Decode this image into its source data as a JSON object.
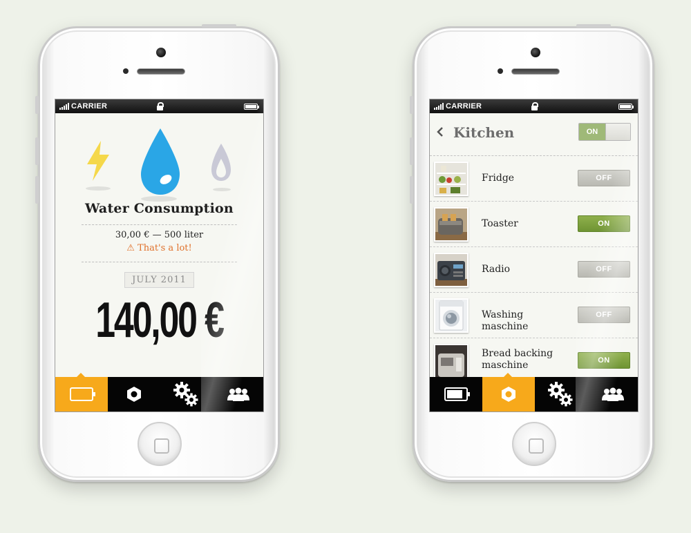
{
  "left_phone": {
    "status": {
      "carrier": "CARRIER"
    },
    "title": "Water Consumption",
    "consumption": {
      "cost": "30,00 €",
      "separator": "—",
      "volume": "500 liter"
    },
    "warning": "⚠ That's a lot!",
    "month": "JULY 2011",
    "amount": "140,00 €",
    "tabs": [
      {
        "icon": "battery-icon",
        "active": true
      },
      {
        "icon": "nut-icon",
        "active": false
      },
      {
        "icon": "gears-icon",
        "active": false
      },
      {
        "icon": "group-icon",
        "active": false
      }
    ]
  },
  "right_phone": {
    "status": {
      "carrier": "CARRIER"
    },
    "title": "Kitchen",
    "master_toggle": "ON",
    "devices": [
      {
        "name": "Fridge",
        "state": "OFF"
      },
      {
        "name": "Toaster",
        "state": "ON"
      },
      {
        "name": "Radio",
        "state": "OFF"
      },
      {
        "name": "Washing maschine",
        "state": "OFF"
      },
      {
        "name": "Bread backing maschine",
        "state": "ON"
      }
    ],
    "tabs": [
      {
        "icon": "battery-icon",
        "active": false
      },
      {
        "icon": "nut-icon",
        "active": true
      },
      {
        "icon": "gears-icon",
        "active": false
      },
      {
        "icon": "group-icon",
        "active": false
      }
    ]
  },
  "colors": {
    "accent_orange": "#f7a91b",
    "water_blue": "#2aa6e6",
    "bolt_yellow": "#f5d84a",
    "toggle_green": "#7fa23f",
    "warning_orange": "#e0702a"
  }
}
